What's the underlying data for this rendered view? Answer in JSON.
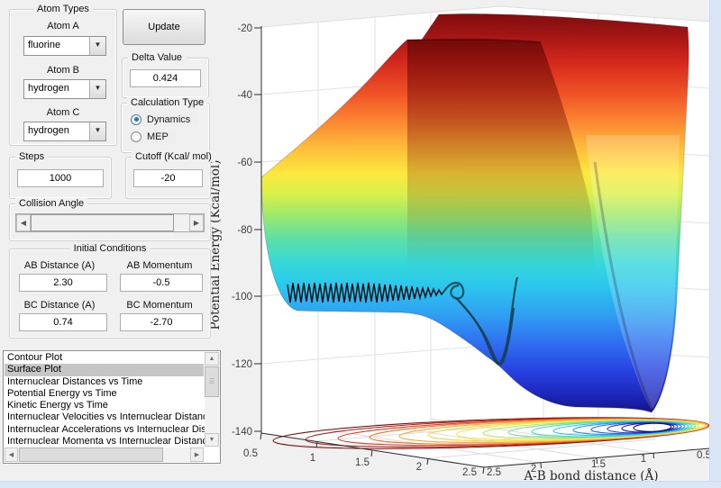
{
  "theme": {
    "background": "#f0f0f0",
    "frame_accent": "#d9e6f5",
    "list_selection": "#c6c6c6",
    "surface_colormap": "jet"
  },
  "panels": {
    "atom_types": {
      "title": "Atom Types",
      "fields": [
        {
          "label": "Atom A",
          "value": "fluorine"
        },
        {
          "label": "Atom B",
          "value": "hydrogen"
        },
        {
          "label": "Atom C",
          "value": "hydrogen"
        }
      ]
    },
    "update_button": {
      "label": "Update"
    },
    "delta": {
      "title": "Delta Value",
      "value": "0.424"
    },
    "calc_type": {
      "title": "Calculation Type",
      "options": [
        {
          "label": "Dynamics",
          "selected": true
        },
        {
          "label": "MEP",
          "selected": false
        }
      ]
    },
    "steps": {
      "title": "Steps",
      "value": "1000"
    },
    "cutoff": {
      "title": "Cutoff (Kcal/ mol)",
      "value": "-20"
    },
    "collision": {
      "title": "Collision Angle"
    },
    "initial": {
      "title": "Initial Conditions",
      "fields": [
        {
          "label": "AB Distance (A)",
          "value": "2.30"
        },
        {
          "label": "AB Momentum",
          "value": "-0.5"
        },
        {
          "label": "BC Distance (A)",
          "value": "0.74"
        },
        {
          "label": "BC Momentum",
          "value": "-2.70"
        }
      ]
    },
    "plot_list": {
      "selected_index": 1,
      "items": [
        "Contour Plot",
        "Surface Plot",
        "Internuclear Distances vs Time",
        "Potential Energy vs Time",
        "Kinetic Energy vs Time",
        "Internuclear Velocities vs Internuclear Distance",
        "Internuclear Accelerations vs Internuclear Dista",
        "Internuclear Momenta vs Internuclear Distance"
      ]
    }
  },
  "chart_data": {
    "type": "surface",
    "title": "",
    "xlabel": "A-B bond distance (Å)",
    "zlabel": "Potential Energy (Kcal/mol)",
    "colormap": "jet",
    "z_range": [
      -140,
      -20
    ],
    "z_ticks": [
      -20,
      -40,
      -60,
      -80,
      -100,
      -120,
      -140
    ],
    "z_tick_labels": [
      "-20",
      "-40",
      "-60",
      "-80",
      "-100",
      "-120",
      "-140"
    ],
    "x_left_axis_ticks": [
      0.5,
      1,
      1.5,
      2,
      2.5
    ],
    "x_left_tick_labels": [
      "0.5",
      "1",
      "1.5",
      "2",
      "2.5"
    ],
    "x_right_axis_ticks": [
      2.5,
      2,
      1.5,
      1,
      0.5
    ],
    "x_right_tick_labels": [
      "2.5",
      "2",
      "1.5",
      "1",
      "0.5"
    ],
    "axis_range_both": [
      0.5,
      2.5
    ],
    "cutoff_clip_kcal_mol": -20,
    "surface_features": {
      "repulsive_walls_clipped_at": -20,
      "front_plateau_level": -25,
      "entrance_valley_floor": -102,
      "exit_well_minimum": -133
    },
    "overlays": [
      "black reaction trajectory oscillating along entrance valley then diving into exit well",
      "jet-colored contour projection on floor plane at z = -140"
    ],
    "grid": true,
    "legend": false
  }
}
